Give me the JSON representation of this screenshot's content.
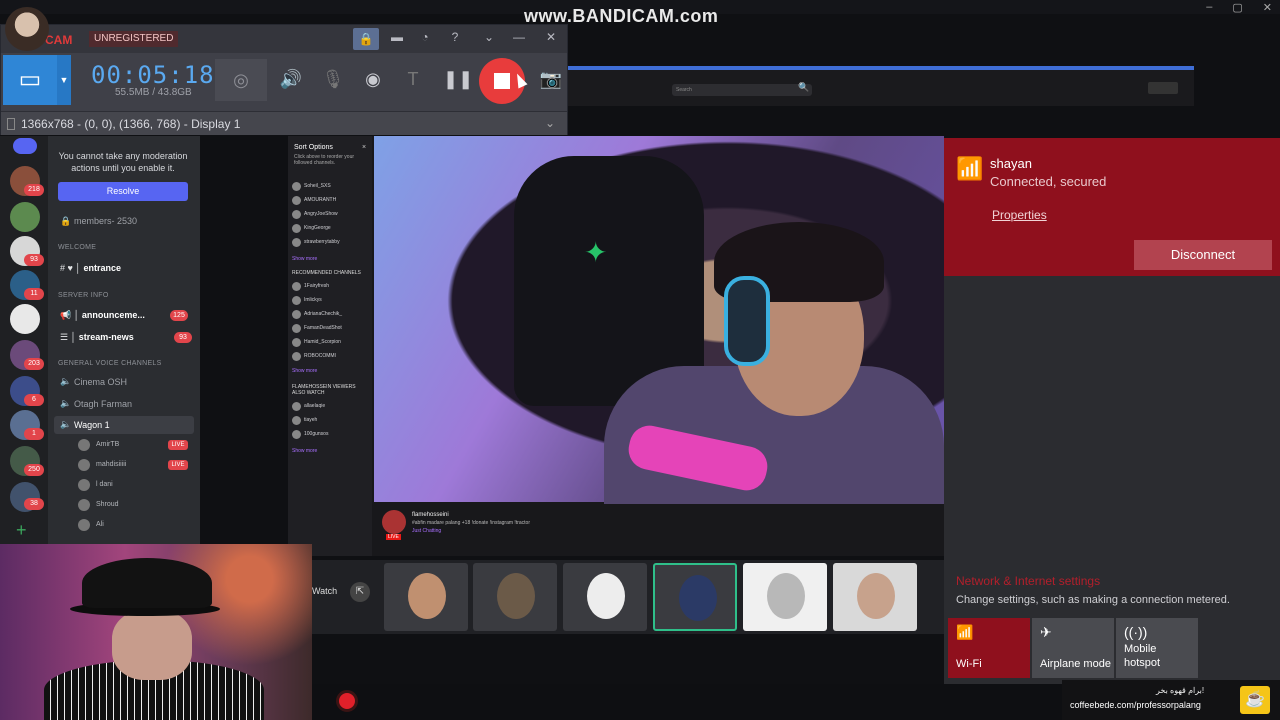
{
  "watermark": "www.BANDICAM.com",
  "bandicam": {
    "brand": "CAM",
    "unregistered": "UNREGISTERED",
    "timer": "00:05:18",
    "filesize": "55.5MB / 43.8GB",
    "region": "1366x768 - (0, 0), (1366, 768) - Display 1",
    "icons": [
      "lock-icon",
      "folder-icon",
      "clock-icon",
      "help-icon",
      "minimize-icon",
      "close-icon",
      "monitor-icon",
      "webcam-icon",
      "speaker-icon",
      "microphone-icon",
      "cursor-click-icon",
      "text-icon",
      "pause-icon",
      "stop-icon",
      "camera-icon"
    ]
  },
  "discord": {
    "warning": "You cannot take any moderation actions until you enable it.",
    "resolve": "Resolve",
    "members": "members- 2530",
    "cat_welcome": "WELCOME",
    "ch_entrance": "entrance",
    "cat_server_info": "SERVER INFO",
    "ch_announcements": "announceme...",
    "ch_announcements_badge": "125",
    "ch_stream_news": "stream-news",
    "ch_stream_news_badge": "93",
    "cat_voice": "GENERAL VOICE CHANNELS",
    "voice1": "Cinema OSH",
    "voice2": "Otagh Farman",
    "voice3": "Wagon 1",
    "users": [
      "AmirTB",
      "mahdisiiiii",
      "l dani",
      "Shroud",
      "Ali"
    ],
    "live": "LIVE",
    "server_badges": [
      "218",
      "93",
      "11",
      "203",
      "6",
      "1",
      "250",
      "38"
    ]
  },
  "twitch": {
    "sort_options": "Sort Options",
    "sort_desc": "Click above to reorder your followed channels.",
    "followed": [
      "Soheil_SXS",
      "AMOURANTH",
      "AngryJoeShow",
      "KingGeorge",
      "strawberrytabby"
    ],
    "show_more": "Show more",
    "recommended_header": "RECOMMENDED CHANNELS",
    "recommended": [
      "1Fairyfresh",
      "Imlickys",
      "AdrianaChechik_",
      "FamanDeadShot",
      "Hamid_Scorpion",
      "ROBOCOMMI"
    ],
    "viewers_header": "FLAMEHOSSEIN VIEWERS ALSO WATCH",
    "also_watch": [
      "allaelaqie",
      "tiayeh",
      "100gunsos"
    ],
    "search_placeholder": "Search",
    "streamer": "flamehosseini",
    "stream_title": "#abfin madare palang +18 !donate !instagram !tractor",
    "stream_sub": "Just Chatting",
    "live": "LIVE",
    "watch": "Watch"
  },
  "wifi": {
    "ssid": "shayan",
    "status": "Connected, secured",
    "properties": "Properties",
    "disconnect": "Disconnect",
    "network_settings": "Network & Internet settings",
    "network_desc": "Change settings, such as making a connection metered.",
    "qa_wifi": "Wi-Fi",
    "qa_airplane": "Airplane mode",
    "qa_hotspot_1": "Mobile",
    "qa_hotspot_2": "hotspot"
  },
  "coffee": {
    "fa": "برام قهوه بخر!",
    "url": "coffeebede.com/professorpalang"
  },
  "colors": {
    "wifi_red": "#8f101d",
    "bandicam_timer": "#5aa9f0",
    "record_red": "#e83c3c",
    "discord_blurple": "#5765f2"
  }
}
